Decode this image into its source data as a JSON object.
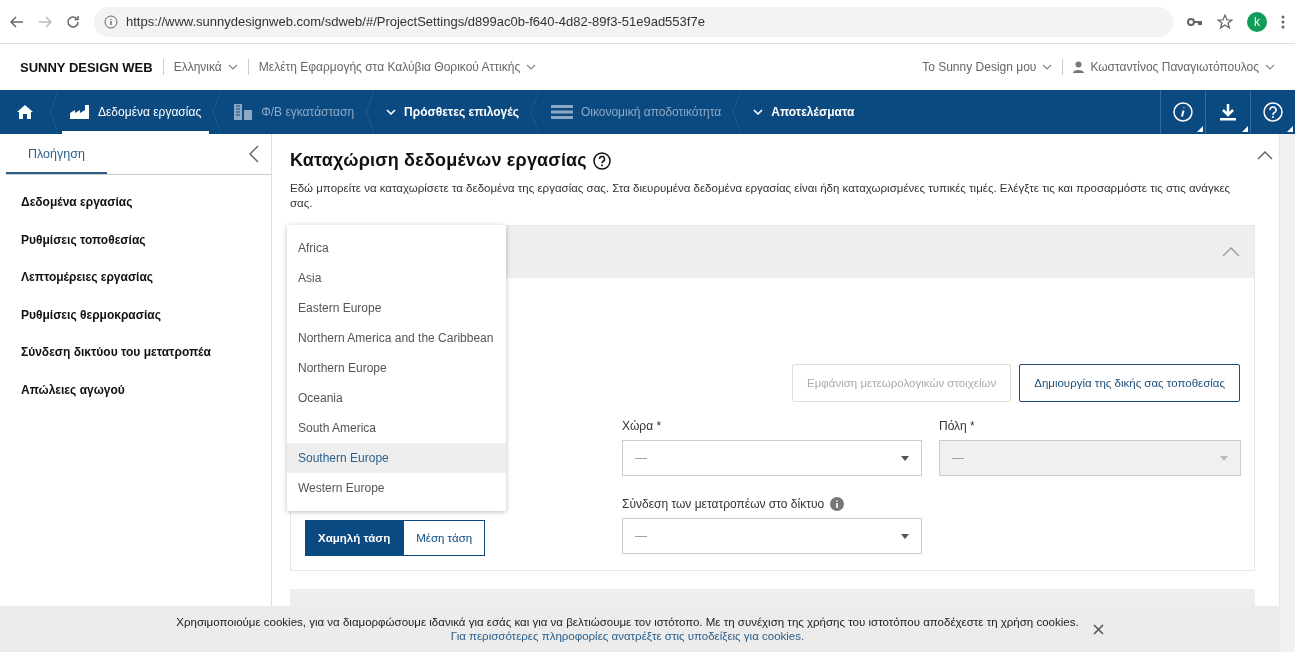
{
  "browser": {
    "url": "https://www.sunnydesignweb.com/sdweb/#/ProjectSettings/d899ac0b-f640-4d82-89f3-51e9ad553f7e",
    "avatar": "k"
  },
  "header": {
    "brand": "SUNNY DESIGN WEB",
    "language": "Ελληνικά",
    "project": "Μελέτη Εφαρμογής στα Καλύβια Θορικού Αττικής",
    "my_link": "Το Sunny Design μου",
    "user": "Κωσταντίνος Παναγιωτόπουλος"
  },
  "nav": {
    "items": [
      {
        "label": "Δεδομένα εργασίας",
        "kind": "step",
        "selected": true,
        "disabled": false
      },
      {
        "label": "Φ/Β εγκατάσταση",
        "kind": "step",
        "selected": false,
        "disabled": true
      },
      {
        "label": "Πρόσθετες επιλογές",
        "kind": "menu",
        "selected": false,
        "disabled": false
      },
      {
        "label": "Οικονομική αποδοτικότητα",
        "kind": "step",
        "selected": false,
        "disabled": true
      },
      {
        "label": "Αποτελέσματα",
        "kind": "menu",
        "selected": false,
        "disabled": false
      }
    ]
  },
  "sidebar": {
    "tab": {
      "label": "Πλοήγηση",
      "selected": true
    },
    "items": [
      "Δεδομένα εργασίας",
      "Ρυθμίσεις τοποθεσίας",
      "Λεπτομέρειες εργασίας",
      "Ρυθμίσεις θερμοκρασίας",
      "Σύνδεση δικτύου του μετατροπέα",
      "Απώλειες αγωγού"
    ]
  },
  "main": {
    "title": "Καταχώριση δεδομένων εργασίας",
    "description": "Εδώ μπορείτε να καταχωρίσετε τα δεδομένα της εργασίας σας. Στα διευρυμένα δεδομένα εργασίας είναι ήδη καταχωρισμένες τυπικές τιμές. Ελέγξτε τις και προσαρμόστε τις στις ανάγκες σας.",
    "buttons": [
      {
        "label": "Εμφάνιση μετεωρολογικών στοιχείων",
        "disabled": true
      },
      {
        "label": "Δημιουργία της δικής σας τοποθεσίας",
        "disabled": false
      }
    ],
    "fields": [
      {
        "label": "Χώρα *",
        "value": "—",
        "disabled": false
      },
      {
        "label": "Πόλη *",
        "value": "—",
        "disabled": true
      }
    ],
    "voltage": [
      {
        "label": "Χαμηλή τάση",
        "selected": true
      },
      {
        "label": "Μέση τάση",
        "selected": false
      }
    ],
    "grid_connection": {
      "label": "Σύνδεση των μετατροπέων στο δίκτυο",
      "value": "—"
    },
    "dropdown": [
      {
        "label": "Africa",
        "selected": false
      },
      {
        "label": "Asia",
        "selected": false
      },
      {
        "label": "Eastern Europe",
        "selected": false
      },
      {
        "label": "Northern America and the Caribbean",
        "selected": false
      },
      {
        "label": "Northern Europe",
        "selected": false
      },
      {
        "label": "Oceania",
        "selected": false
      },
      {
        "label": "South America",
        "selected": false
      },
      {
        "label": "Southern Europe",
        "selected": true
      },
      {
        "label": "Western Europe",
        "selected": false
      }
    ]
  },
  "cookie": {
    "text": "Χρησιμοποιούμε cookies, για να διαμορφώσουμε ιδανικά για εσάς και για να βελτιώσουμε τον ιστότοπο. Με τη συνέχιση της χρήσης του ιστοτόπου αποδέχεστε τη χρήση cookies.",
    "link": "Για περισσότερες πληροφορίες ανατρέξτε στις υποδείξεις για cookies."
  }
}
